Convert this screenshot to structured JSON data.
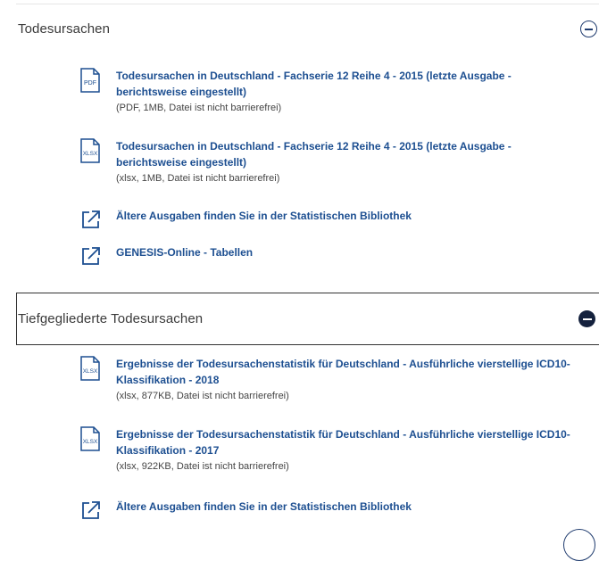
{
  "sections": [
    {
      "title": "Todesursachen",
      "items": [
        {
          "icon": "pdf-file-icon",
          "icon_text": "PDF",
          "link": "Todesursachen in Deutschland - Fachserie 12 Reihe 4 - 2015 (letzte Ausgabe - berichtsweise eingestellt)",
          "meta": "(PDF, 1MB, Datei ist nicht barrierefrei)"
        },
        {
          "icon": "xlsx-file-icon",
          "icon_text": "XLSX",
          "link": "Todesursachen in Deutschland - Fachserie 12 Reihe 4 - 2015 (letzte Ausgabe - berichtsweise eingestellt)",
          "meta": "(xlsx, 1MB, Datei ist nicht barrierefrei)"
        },
        {
          "icon": "external-link-icon",
          "link": "Ältere Ausgaben finden Sie in der Statistischen Bibliothek"
        },
        {
          "icon": "external-link-icon",
          "link": "GENESIS-Online - Tabellen"
        }
      ]
    },
    {
      "title": "Tiefgegliederte Todesursachen",
      "items": [
        {
          "icon": "xlsx-file-icon",
          "icon_text": "XLSX",
          "link": "Ergebnisse der Todesursachenstatistik für Deutschland - Ausführliche vierstellige ICD10-Klassifikation - 2018",
          "meta": "(xlsx, 877KB, Datei ist nicht barrierefrei)"
        },
        {
          "icon": "xlsx-file-icon",
          "icon_text": "XLSX",
          "link": "Ergebnisse der Todesursachenstatistik für Deutschland - Ausführliche vierstellige ICD10-Klassifikation - 2017",
          "meta": "(xlsx, 922KB, Datei ist nicht barrierefrei)"
        },
        {
          "icon": "external-link-icon",
          "link": "Ältere Ausgaben finden Sie in der Statistischen Bibliothek"
        }
      ]
    }
  ],
  "colors": {
    "link": "#1d4f91",
    "toggle_filled": "#14213d",
    "toggle_outline": "#1f3b6e"
  }
}
